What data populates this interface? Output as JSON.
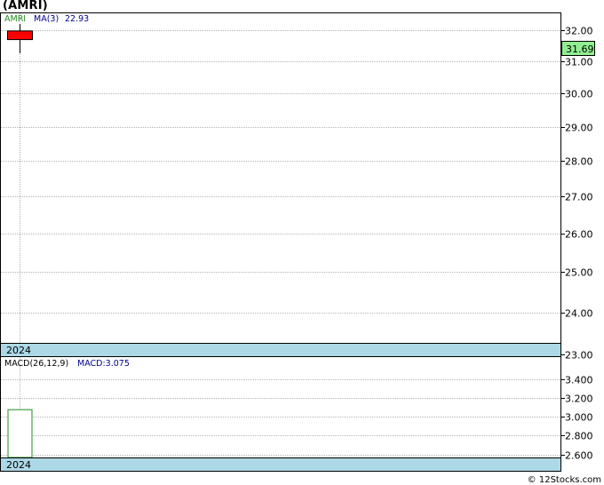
{
  "title": "(AMRI)",
  "credit": "© 12Stocks.com",
  "colors": {
    "grid": "#b4b4b4",
    "candle_down": "#ff0000",
    "year_band": "#add8e6",
    "price_box": "#90ee90",
    "ticker_text": "#228b22",
    "ma_text": "#00008b",
    "macd_bar_border": "#228b22"
  },
  "chart_data": [
    {
      "type": "candlestick",
      "legend": {
        "ticker": "AMRI",
        "ma_label": "MA(3)",
        "ma_value": "22.93"
      },
      "year_label": "2024",
      "current_price_label": "31.69",
      "yticks": [
        "32.00",
        "31.00",
        "30.00",
        "29.00",
        "28.00",
        "27.00",
        "26.00",
        "25.00",
        "24.00",
        "23.00"
      ],
      "ytick_values": [
        32,
        31,
        30,
        29,
        28,
        27,
        26,
        25,
        24,
        23
      ],
      "ylim": [
        22.95,
        32.55
      ],
      "ylog": true,
      "candles": [
        {
          "open": 31.97,
          "high": 32.2,
          "low": 31.25,
          "close": 31.69
        }
      ],
      "grid": true
    },
    {
      "type": "bar",
      "legend": {
        "label": "MACD(26,12,9)",
        "macd_label": "MACD:3.075"
      },
      "year_label": "2024",
      "yticks": [
        "3.400",
        "3.200",
        "3.000",
        "2.800",
        "2.600"
      ],
      "ytick_values": [
        3.4,
        3.2,
        3.0,
        2.8,
        2.6
      ],
      "ylim": [
        2.57,
        3.63
      ],
      "values": [
        3.075
      ],
      "grid": true
    }
  ]
}
